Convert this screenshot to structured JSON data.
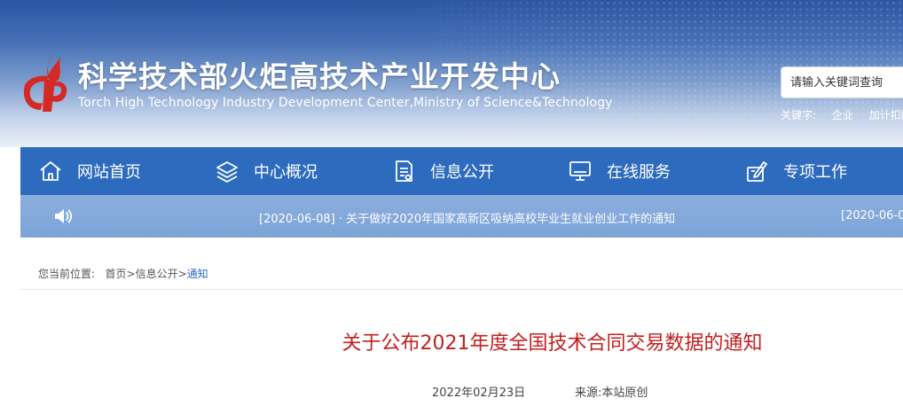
{
  "header": {
    "site_title": "科学技术部火炬高技术产业开发中心",
    "site_subtitle": "Torch High Technology Industry Development Center,Ministry of Science&Technology",
    "search_placeholder": "请输入关键词查询",
    "keywords_label": "关键字:",
    "keywords": [
      "企业",
      "加计扣除"
    ]
  },
  "nav": {
    "items": [
      {
        "label": "网站首页",
        "icon": "home-icon"
      },
      {
        "label": "中心概况",
        "icon": "layers-icon"
      },
      {
        "label": "信息公开",
        "icon": "document-icon"
      },
      {
        "label": "在线服务",
        "icon": "monitor-icon"
      },
      {
        "label": "专项工作",
        "icon": "pen-icon"
      }
    ]
  },
  "ticker": {
    "icon": "speaker-icon",
    "items": [
      "[2020-06-08] · 关于做好2020年国家高新区吸纳高校毕业生就业创业工作的通知",
      "[2020-06-0"
    ]
  },
  "breadcrumb": {
    "label": "您当前位置:",
    "items": [
      "首页",
      "信息公开",
      "通知"
    ],
    "separator": ">"
  },
  "article": {
    "title": "关于公布2021年度全国技术合同交易数据的通知",
    "date": "2022年02月23日",
    "source": "来源:本站原创"
  },
  "colors": {
    "nav_bg": "#2d6bbe",
    "ticker_bg": "#7ea4d7",
    "title_red": "#c21f1f",
    "logo_red": "#d42a24"
  }
}
